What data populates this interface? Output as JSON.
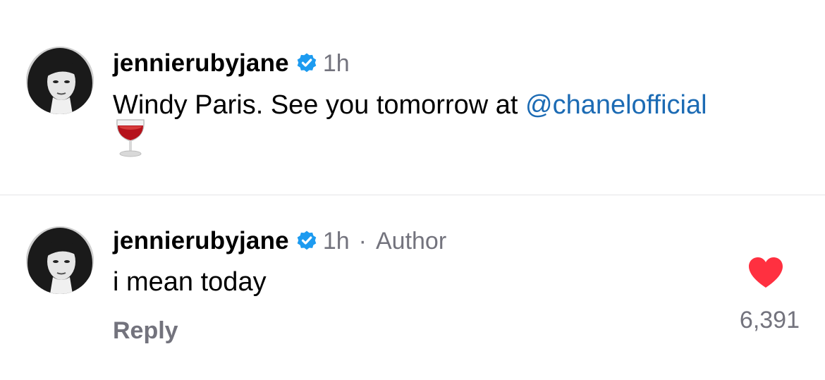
{
  "post": {
    "username": "jennierubyjane",
    "time": "1h",
    "caption_text": "Windy Paris. See you tomorrow at ",
    "caption_mention": "@chanelofficial",
    "caption_emoji": "wine-glass-icon"
  },
  "comment": {
    "username": "jennierubyjane",
    "time": "1h",
    "separator": "·",
    "author_label": "Author",
    "text": "i mean today",
    "reply_label": "Reply",
    "like_count": "6,391"
  },
  "icons": {
    "verified": "verified-badge-icon",
    "heart": "heart-icon",
    "avatar": "avatar"
  },
  "colors": {
    "text": "#000000",
    "secondary": "#73737d",
    "mention": "#1c6bb4",
    "verified": "#1d9bf0",
    "heart": "#ff3040",
    "divider": "#e4e4e7"
  }
}
